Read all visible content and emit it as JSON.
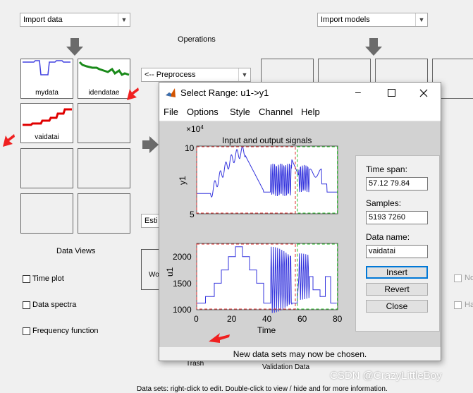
{
  "main": {
    "import_data": "Import data",
    "import_models": "Import models",
    "operations": "Operations",
    "preprocess": "<-- Preprocess",
    "estimate_partial": "Esti",
    "working_partial": "Wo",
    "data_views": "Data Views",
    "time_plot": "Time plot",
    "data_spectra": "Data spectra",
    "frequency_function": "Frequency function",
    "trash": "Trash",
    "validation_data": "Validation Data",
    "right_check_1": "No",
    "right_check_2": "Ha",
    "bottom_text": "Data sets: right-click to edit. Double-click to view / hide and for more information.",
    "tiles": [
      "mydata",
      "idendatae",
      "vaidatai"
    ]
  },
  "dialog": {
    "title": "Select Range: u1->y1",
    "menu": [
      "File",
      "Options",
      "Style",
      "Channel",
      "Help"
    ],
    "time_span_label": "Time span:",
    "time_span_value": "57.12 79.84",
    "samples_label": "Samples:",
    "samples_value": "5193 7260",
    "data_name_label": "Data name:",
    "data_name_value": "vaidatai",
    "insert": "Insert",
    "revert": "Revert",
    "close": "Close",
    "status": "New data sets may now be chosen."
  },
  "chart_data": [
    {
      "type": "line",
      "title": "Input and output signals",
      "exponent": "×10",
      "exponent_power": "4",
      "ylabel": "y1",
      "xlim": [
        0,
        80
      ],
      "ylim": [
        5,
        10
      ],
      "yticks": [
        "10",
        "5"
      ],
      "selection_red": [
        0,
        56
      ],
      "selection_green": [
        57.12,
        79.84
      ],
      "line_color": "#3333dd"
    },
    {
      "type": "line",
      "ylabel": "u1",
      "xlabel": "Time",
      "xlim": [
        0,
        80
      ],
      "ylim": [
        1000,
        2000
      ],
      "yticks": [
        "2000",
        "1500",
        "1000"
      ],
      "xticks": [
        "0",
        "20",
        "40",
        "60",
        "80"
      ],
      "line_color": "#3333dd"
    }
  ],
  "watermark": "CSDN @CrazyLittleBoy"
}
